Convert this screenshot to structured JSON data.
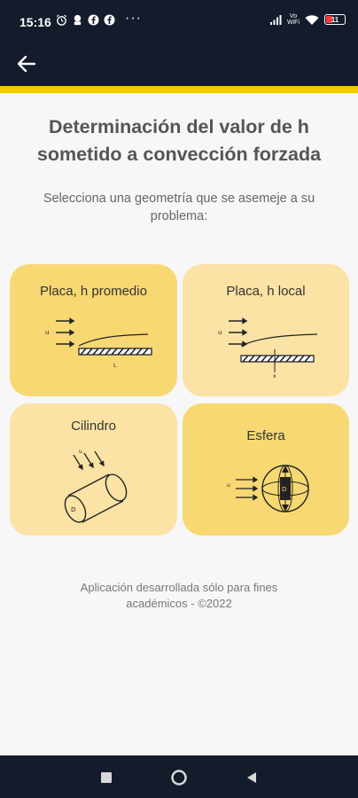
{
  "status_bar": {
    "time": "15:16",
    "more_dots": "···",
    "volte_top": "Vo",
    "volte_bottom": "WiFi",
    "battery": "11"
  },
  "header": {
    "title_line1": "Determinación del valor de h",
    "title_line2": "sometido a convección forzada",
    "subtitle_line1": "Selecciona una geometría que se asemeje a su",
    "subtitle_line2": "problema:"
  },
  "cards": [
    {
      "label": "Placa, h promedio",
      "icon": "flat-plate-average-diagram"
    },
    {
      "label": "Placa, h local",
      "icon": "flat-plate-local-diagram"
    },
    {
      "label": "Cilindro",
      "icon": "cylinder-diagram"
    },
    {
      "label": "Esfera",
      "icon": "sphere-diagram"
    }
  ],
  "footer": {
    "line1": "Aplicación desarrollada sólo para fines",
    "line2": "académicos -  ©2022"
  },
  "colors": {
    "app_bar": "#141b2b",
    "accent": "#f6c60b",
    "card_yellow": "#f7d872",
    "card_light": "#fbe3a5"
  }
}
